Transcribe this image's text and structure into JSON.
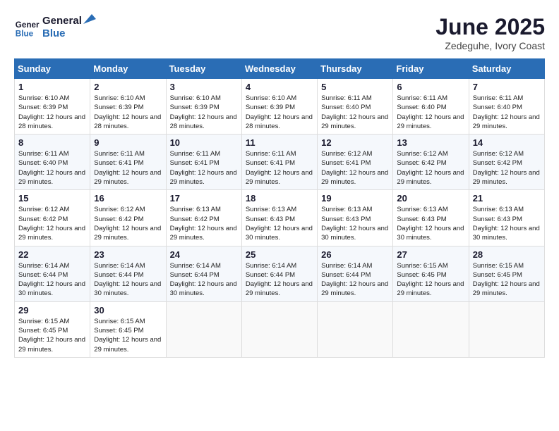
{
  "logo": {
    "line1": "General",
    "line2": "Blue"
  },
  "title": "June 2025",
  "location": "Zedeguhe, Ivory Coast",
  "days_of_week": [
    "Sunday",
    "Monday",
    "Tuesday",
    "Wednesday",
    "Thursday",
    "Friday",
    "Saturday"
  ],
  "weeks": [
    [
      {
        "day": 1,
        "sunrise": "6:10 AM",
        "sunset": "6:39 PM",
        "daylight": "12 hours and 28 minutes."
      },
      {
        "day": 2,
        "sunrise": "6:10 AM",
        "sunset": "6:39 PM",
        "daylight": "12 hours and 28 minutes."
      },
      {
        "day": 3,
        "sunrise": "6:10 AM",
        "sunset": "6:39 PM",
        "daylight": "12 hours and 28 minutes."
      },
      {
        "day": 4,
        "sunrise": "6:10 AM",
        "sunset": "6:39 PM",
        "daylight": "12 hours and 28 minutes."
      },
      {
        "day": 5,
        "sunrise": "6:11 AM",
        "sunset": "6:40 PM",
        "daylight": "12 hours and 29 minutes."
      },
      {
        "day": 6,
        "sunrise": "6:11 AM",
        "sunset": "6:40 PM",
        "daylight": "12 hours and 29 minutes."
      },
      {
        "day": 7,
        "sunrise": "6:11 AM",
        "sunset": "6:40 PM",
        "daylight": "12 hours and 29 minutes."
      }
    ],
    [
      {
        "day": 8,
        "sunrise": "6:11 AM",
        "sunset": "6:40 PM",
        "daylight": "12 hours and 29 minutes."
      },
      {
        "day": 9,
        "sunrise": "6:11 AM",
        "sunset": "6:41 PM",
        "daylight": "12 hours and 29 minutes."
      },
      {
        "day": 10,
        "sunrise": "6:11 AM",
        "sunset": "6:41 PM",
        "daylight": "12 hours and 29 minutes."
      },
      {
        "day": 11,
        "sunrise": "6:11 AM",
        "sunset": "6:41 PM",
        "daylight": "12 hours and 29 minutes."
      },
      {
        "day": 12,
        "sunrise": "6:12 AM",
        "sunset": "6:41 PM",
        "daylight": "12 hours and 29 minutes."
      },
      {
        "day": 13,
        "sunrise": "6:12 AM",
        "sunset": "6:42 PM",
        "daylight": "12 hours and 29 minutes."
      },
      {
        "day": 14,
        "sunrise": "6:12 AM",
        "sunset": "6:42 PM",
        "daylight": "12 hours and 29 minutes."
      }
    ],
    [
      {
        "day": 15,
        "sunrise": "6:12 AM",
        "sunset": "6:42 PM",
        "daylight": "12 hours and 29 minutes."
      },
      {
        "day": 16,
        "sunrise": "6:12 AM",
        "sunset": "6:42 PM",
        "daylight": "12 hours and 29 minutes."
      },
      {
        "day": 17,
        "sunrise": "6:13 AM",
        "sunset": "6:42 PM",
        "daylight": "12 hours and 29 minutes."
      },
      {
        "day": 18,
        "sunrise": "6:13 AM",
        "sunset": "6:43 PM",
        "daylight": "12 hours and 30 minutes."
      },
      {
        "day": 19,
        "sunrise": "6:13 AM",
        "sunset": "6:43 PM",
        "daylight": "12 hours and 30 minutes."
      },
      {
        "day": 20,
        "sunrise": "6:13 AM",
        "sunset": "6:43 PM",
        "daylight": "12 hours and 30 minutes."
      },
      {
        "day": 21,
        "sunrise": "6:13 AM",
        "sunset": "6:43 PM",
        "daylight": "12 hours and 30 minutes."
      }
    ],
    [
      {
        "day": 22,
        "sunrise": "6:14 AM",
        "sunset": "6:44 PM",
        "daylight": "12 hours and 30 minutes."
      },
      {
        "day": 23,
        "sunrise": "6:14 AM",
        "sunset": "6:44 PM",
        "daylight": "12 hours and 30 minutes."
      },
      {
        "day": 24,
        "sunrise": "6:14 AM",
        "sunset": "6:44 PM",
        "daylight": "12 hours and 30 minutes."
      },
      {
        "day": 25,
        "sunrise": "6:14 AM",
        "sunset": "6:44 PM",
        "daylight": "12 hours and 29 minutes."
      },
      {
        "day": 26,
        "sunrise": "6:14 AM",
        "sunset": "6:44 PM",
        "daylight": "12 hours and 29 minutes."
      },
      {
        "day": 27,
        "sunrise": "6:15 AM",
        "sunset": "6:45 PM",
        "daylight": "12 hours and 29 minutes."
      },
      {
        "day": 28,
        "sunrise": "6:15 AM",
        "sunset": "6:45 PM",
        "daylight": "12 hours and 29 minutes."
      }
    ],
    [
      {
        "day": 29,
        "sunrise": "6:15 AM",
        "sunset": "6:45 PM",
        "daylight": "12 hours and 29 minutes."
      },
      {
        "day": 30,
        "sunrise": "6:15 AM",
        "sunset": "6:45 PM",
        "daylight": "12 hours and 29 minutes."
      },
      null,
      null,
      null,
      null,
      null
    ]
  ]
}
